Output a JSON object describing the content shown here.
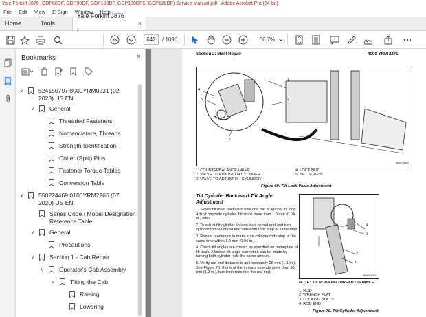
{
  "window": {
    "title": "Yale Forklift J876 (GDP80DF, GDP90DF, GDP100DF, GDP100DFS, GDP120DF) Service Manual.pdf - Adobe Acrobat Pro (64-bit)"
  },
  "menu": [
    "File",
    "Edit",
    "View",
    "E-Sign",
    "Window",
    "Help"
  ],
  "tabs": {
    "home": "Home",
    "tools": "Tools",
    "document": "Yale Forklift J876 (...",
    "close": "×"
  },
  "toolbar": {
    "current_page": "642",
    "total_pages": "/ 1096",
    "zoom": "66.7%"
  },
  "bookmarks": {
    "title": "Bookmarks",
    "close": "×",
    "items": [
      {
        "label": "524150797 8000YRM0231 (02 2023) US EN",
        "level": 0,
        "expanded": true
      },
      {
        "label": "General",
        "level": 1,
        "expanded": true
      },
      {
        "label": "Threaded Fasteners",
        "level": 2
      },
      {
        "label": "Nomenclature, Threads",
        "level": 2
      },
      {
        "label": "Strength Identification",
        "level": 2
      },
      {
        "label": "Cotter (Split) Pins",
        "level": 2
      },
      {
        "label": "Fastener Torque Tables",
        "level": 2
      },
      {
        "label": "Conversion Table",
        "level": 2
      },
      {
        "label": "550224469 0100YRM2265 (07 2020) US EN",
        "level": 0,
        "expanded": true
      },
      {
        "label": "Series Code / Model Designation Reference Table",
        "level": 1
      },
      {
        "label": "General",
        "level": 1,
        "expanded": true
      },
      {
        "label": "Precautions",
        "level": 2
      },
      {
        "label": "Section 1 - Cab Repair",
        "level": 1,
        "expanded": true
      },
      {
        "label": "Operator's Cab Assembly",
        "level": 2,
        "expanded": true
      },
      {
        "label": "Tilting the Cab",
        "level": 3,
        "expanded": true
      },
      {
        "label": "Raising",
        "level": 4
      },
      {
        "label": "Lowering",
        "level": 4
      }
    ]
  },
  "pdf": {
    "section": "Section 2: Mast Repair",
    "doc_number": "4000 YRM 2271",
    "fig69": {
      "legend_left": [
        "1. COUNTERBALANCE VALVE",
        "2. VALVE TO ADJUST LH CYLINDER",
        "3. VALVE TO ADJUST RH CYLINDER"
      ],
      "legend_right": [
        "4. LOCK NUT",
        "5. SET SCREW"
      ],
      "caption": "Figure 69. Tilt Lock Valve Adjustment",
      "code": "BM070851"
    },
    "heading": "Tilt Cylinder Backward Tilt Angle Adjustment",
    "steps": [
      "1. Slowly tilt mast backward until one rod is against its stop. Adjust opposite cylinder if it stops more than 1.0 mm (0.04 in.) later.",
      "2. To adjust tilt cylinder, loosen nuts on rod end and turn cylinder rod out of rod end until both rods stop at same time.",
      "3. Repeat procedure to make sure cylinder rods stop at the same time within 1.0 mm (0.04 in.).",
      "4. Check tilt angles are correct as specified on nameplate of lift truck. A limited tilt angle correction can be made by turning both cylinder rods the same amount.",
      "5. Verify rod end distance is approximately 28 mm (1.1 in.). See Figure 70. If one of the threads extends more than 30 mm (1.2 in.), turn both rods into the rod end."
    ],
    "fig70": {
      "note": "NOTE:  X = ROD END THREAD DISTANCE",
      "legend": [
        "1. ROD",
        "2. WRENCH FLAT",
        "3. LOCKING BOLTS",
        "4. ROD END"
      ],
      "caption": "Figure 70. Tilt Cylinder Adjustment",
      "code": "BM051651"
    },
    "fig_numbers": [
      "1",
      "2",
      "3",
      "4",
      "5"
    ]
  }
}
